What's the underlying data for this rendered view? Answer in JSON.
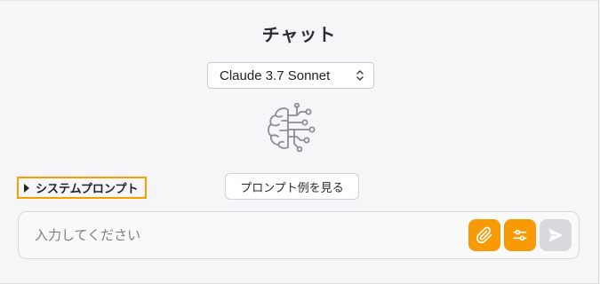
{
  "page": {
    "title": "チャット"
  },
  "model_selector": {
    "selected": "Claude 3.7 Sonnet",
    "icon": "chevron-up-down-icon"
  },
  "logo": {
    "icon": "brain-circuit-icon"
  },
  "system_prompt": {
    "label": "システムプロンプト",
    "icon": "triangle-right-icon",
    "highlight_color": "#f5a000"
  },
  "examples_button": {
    "label": "プロンプト例を見る"
  },
  "chat_input": {
    "placeholder": "入力してください",
    "value": ""
  },
  "buttons": {
    "attach_icon": "paperclip-icon",
    "settings_icon": "sliders-icon",
    "send_icon": "send-icon",
    "accent_color": "#f79a06",
    "disabled_color": "#d9d9dd"
  }
}
